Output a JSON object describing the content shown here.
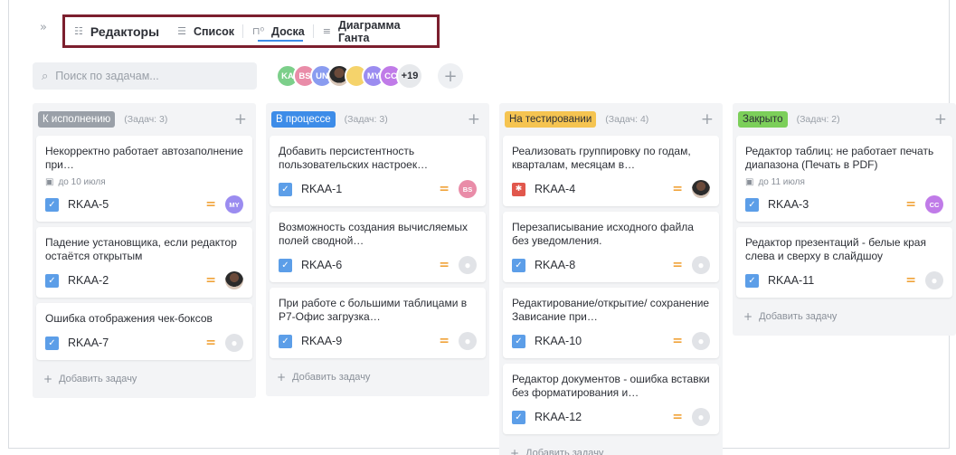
{
  "nav": {
    "collapse_glyph": "»",
    "project_icon": "project-grid-icon",
    "project_name": "Редакторы",
    "tabs": [
      {
        "label": "Список",
        "icon": "list-icon",
        "glyph": "☰"
      },
      {
        "label": "Доска",
        "icon": "board-icon",
        "glyph": "⊓⁰",
        "active": true
      },
      {
        "label": "Диаграмма Ганта",
        "icon": "gantt-icon",
        "glyph": "≡"
      }
    ]
  },
  "search": {
    "placeholder": "Поиск по задачам..."
  },
  "members": {
    "avatars": [
      {
        "initials": "KA",
        "color": "#7ccf8a"
      },
      {
        "initials": "BS",
        "color": "#e98ca8"
      },
      {
        "initials": "UN",
        "color": "#8a9cf0"
      },
      {
        "initials": "",
        "photo": true
      },
      {
        "initials": "",
        "color": "#f5d36b"
      },
      {
        "initials": "MY",
        "color": "#9b8cf0"
      },
      {
        "initials": "CC",
        "color": "#c07be8"
      }
    ],
    "more": "+19"
  },
  "colors": {
    "todo": "#9aa0a8",
    "in_progress": "#3d8ce8",
    "testing": "#f5c451",
    "closed": "#7ccf5a",
    "priority": "#f0a33a",
    "check": "#5c9ee8"
  },
  "columns": [
    {
      "status": "К исполнению",
      "count": "(Задач: 3)",
      "cards": [
        {
          "title": "Некорректно работает автозаполнение при…",
          "due": "до 10 июля",
          "key": "RKAA-5",
          "assignee": {
            "initials": "MY",
            "color": "#9b8cf0"
          }
        },
        {
          "title": "Падение установщика, если редактор остаётся открытым",
          "key": "RKAA-2",
          "assignee": {
            "photo": true
          }
        },
        {
          "title": "Ошибка отображения чек-боксов",
          "key": "RKAA-7",
          "assignee": {
            "empty": true
          }
        }
      ],
      "add_task": "Добавить задачу"
    },
    {
      "status": "В процессе",
      "count": "(Задач: 3)",
      "cards": [
        {
          "title": "Добавить персистентность пользовательских настроек…",
          "key": "RKAA-1",
          "assignee": {
            "initials": "BS",
            "color": "#e98ca8"
          }
        },
        {
          "title": "Возможность создания вычисляемых полей сводной…",
          "key": "RKAA-6",
          "assignee": {
            "empty": true
          }
        },
        {
          "title": "При работе с большими таблицами в Р7-Офис загрузка…",
          "key": "RKAA-9",
          "assignee": {
            "empty": true
          }
        }
      ],
      "add_task": "Добавить задачу"
    },
    {
      "status": "На тестировании",
      "count": "(Задач: 4)",
      "cards": [
        {
          "title": "Реализовать группировку по годам, кварталам, месяцам в…",
          "key": "RKAA-4",
          "bug": true,
          "assignee": {
            "photo": true
          }
        },
        {
          "title": "Перезаписывание исходного файла без уведомления.",
          "key": "RKAA-8",
          "assignee": {
            "empty": true
          }
        },
        {
          "title": "Редактирование/открытие/ сохранение Зависание при…",
          "key": "RKAA-10",
          "assignee": {
            "empty": true
          }
        },
        {
          "title": "Редактор документов - ошибка вставки без форматирования и…",
          "key": "RKAA-12",
          "assignee": {
            "empty": true
          }
        }
      ],
      "add_task": "Добавить задачу"
    },
    {
      "status": "Закрыто",
      "count": "(Задач: 2)",
      "cards": [
        {
          "title": "Редактор таблиц: не работает печать диапазона (Печать в PDF)",
          "due": "до 11 июля",
          "key": "RKAA-3",
          "assignee": {
            "initials": "CC",
            "color": "#c07be8"
          }
        },
        {
          "title": "Редактор презентаций - белые края слева и сверху в слайдшоу",
          "key": "RKAA-11",
          "assignee": {
            "empty": true
          }
        }
      ],
      "add_task": "Добавить задачу"
    }
  ]
}
